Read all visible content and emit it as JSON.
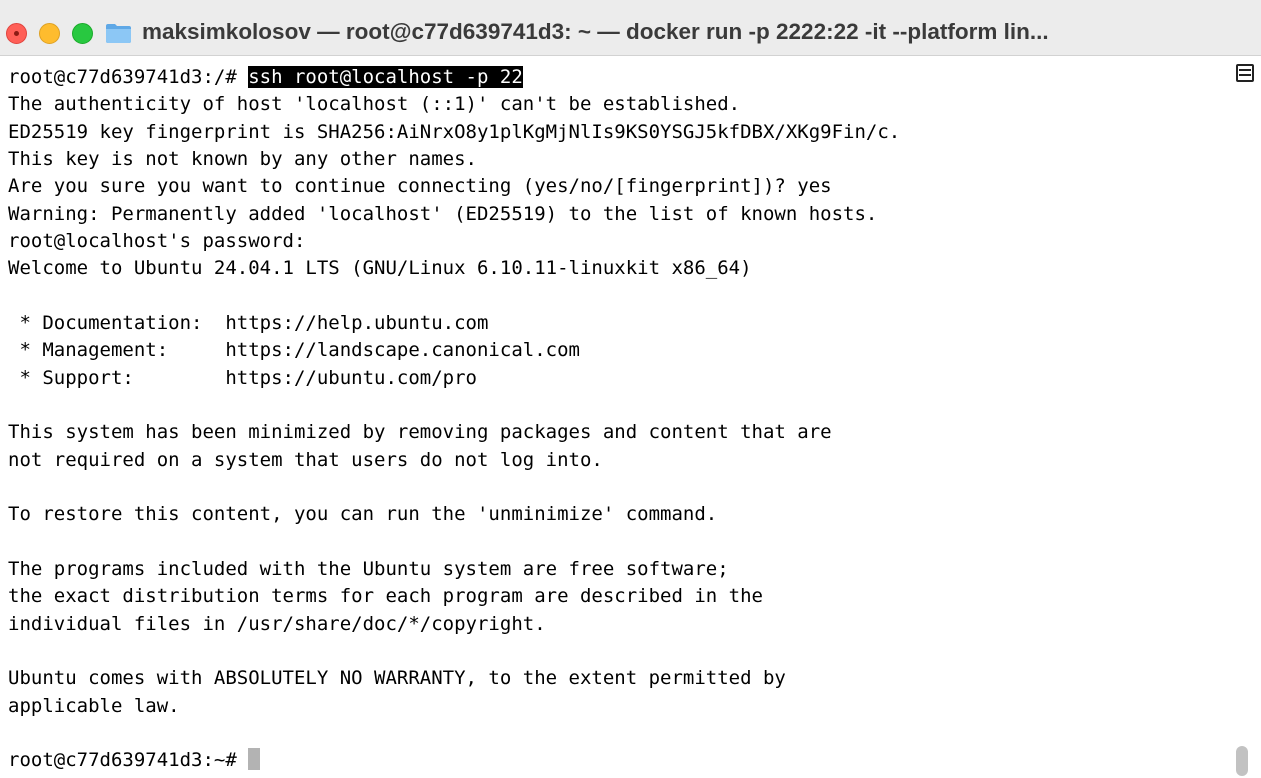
{
  "window": {
    "title": "maksimkolosov — root@c77d639741d3: ~ — docker run -p 2222:22 -it --platform lin...",
    "folder_icon": "folder-icon"
  },
  "colors": {
    "title_bar": "#ececec",
    "close": "#ff5f57",
    "minimize": "#febc2e",
    "zoom": "#28c840",
    "selection": "#000000"
  },
  "terminal": {
    "prompt1": "root@c77d639741d3:/# ",
    "command1": "ssh root@localhost -p 22",
    "lines": [
      "The authenticity of host 'localhost (::1)' can't be established.",
      "ED25519 key fingerprint is SHA256:AiNrxO8y1plKgMjNlIs9KS0YSGJ5kfDBX/XKg9Fin/c.",
      "This key is not known by any other names.",
      "Are you sure you want to continue connecting (yes/no/[fingerprint])? yes",
      "Warning: Permanently added 'localhost' (ED25519) to the list of known hosts.",
      "root@localhost's password:",
      "Welcome to Ubuntu 24.04.1 LTS (GNU/Linux 6.10.11-linuxkit x86_64)",
      "",
      " * Documentation:  https://help.ubuntu.com",
      " * Management:     https://landscape.canonical.com",
      " * Support:        https://ubuntu.com/pro",
      "",
      "This system has been minimized by removing packages and content that are",
      "not required on a system that users do not log into.",
      "",
      "To restore this content, you can run the 'unminimize' command.",
      "",
      "The programs included with the Ubuntu system are free software;",
      "the exact distribution terms for each program are described in the",
      "individual files in /usr/share/doc/*/copyright.",
      "",
      "Ubuntu comes with ABSOLUTELY NO WARRANTY, to the extent permitted by",
      "applicable law.",
      ""
    ],
    "prompt_final": "root@c77d639741d3:~# "
  }
}
